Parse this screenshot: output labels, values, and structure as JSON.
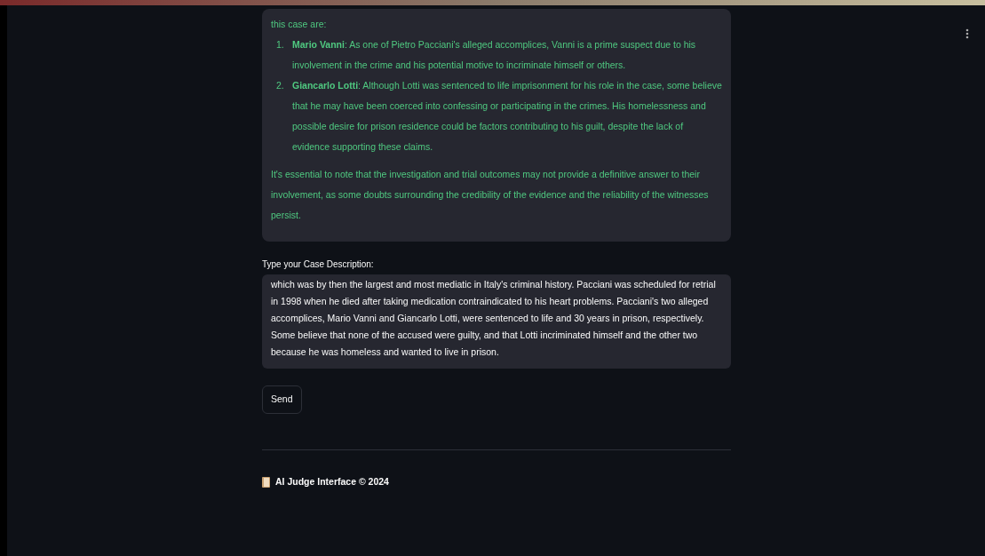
{
  "response": {
    "intro": "this case are:",
    "suspects": [
      {
        "marker": "1.",
        "name": "Mario Vanni",
        "text": ": As one of Pietro Pacciani's alleged accomplices, Vanni is a prime suspect due to his involvement in the crime and his potential motive to incriminate himself or others."
      },
      {
        "marker": "2.",
        "name": "Giancarlo Lotti",
        "text": ": Although Lotti was sentenced to life imprisonment for his role in the case, some believe that he may have been coerced into confessing or participating in the crimes. His homelessness and possible desire for prison residence could be factors contributing to his guilt, despite the lack of evidence supporting these claims."
      }
    ],
    "conclusion": "It's essential to note that the investigation and trial outcomes may not provide a definitive answer to their involvement, as some doubts surrounding the credibility of the evidence and the reliability of the witnesses persist."
  },
  "input": {
    "label": "Type your Case Description:",
    "value": "which was by then the largest and most mediatic in Italy's criminal history. Pacciani was scheduled for retrial in 1998 when he died after taking medication contraindicated to his heart problems. Pacciani's two alleged accomplices, Mario Vanni and Giancarlo Lotti, were sentenced to life and 30 years in prison, respectively. Some believe that none of the accused were guilty, and that Lotti incriminated himself and the other two because he was homeless and wanted to live in prison."
  },
  "send_button": "Send",
  "footer": "AI Judge Interface © 2024"
}
